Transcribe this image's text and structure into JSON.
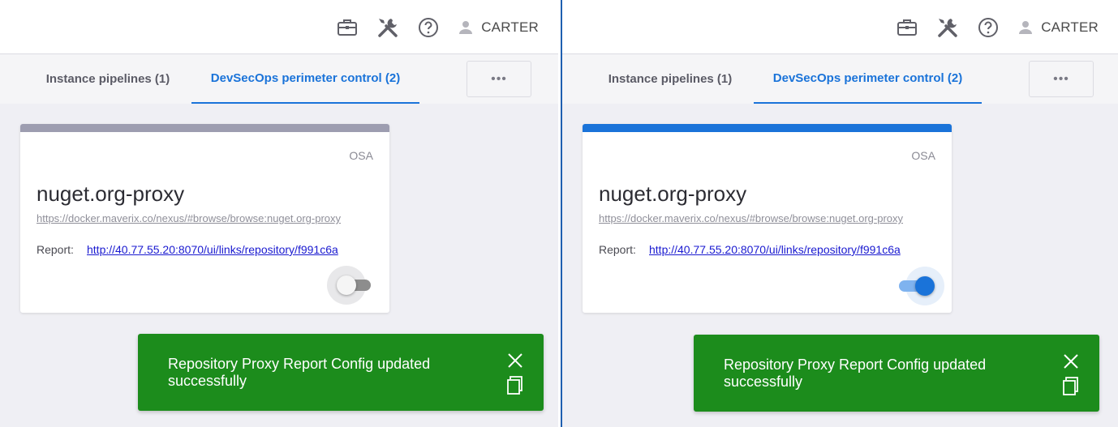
{
  "header": {
    "username": "CARTER",
    "icons": [
      "briefcase-icon",
      "tools-icon",
      "help-icon",
      "user-icon"
    ]
  },
  "tabs": [
    {
      "label": "Instance pipelines (1)",
      "active": false
    },
    {
      "label": "DevSecOps perimeter control (2)",
      "active": true
    }
  ],
  "more_label": "•••",
  "card": {
    "tag": "OSA",
    "title": "nuget.org-proxy",
    "url": "https://docker.maverix.co/nexus/#browse/browse:nuget.org-proxy",
    "report_label": "Report:",
    "report_link": "http://40.77.55.20:8070/ui/links/repository/f991c6a"
  },
  "panels": {
    "left": {
      "stripe_color": "#9d9db0",
      "toggle_on": false
    },
    "right": {
      "stripe_color": "#1a73d9",
      "toggle_on": true
    }
  },
  "toast": {
    "message": "Repository Proxy Report Config updated successfully",
    "background": "#1c8c1c"
  },
  "colors": {
    "accent": "#1a73d9",
    "divider": "#1f5fb0"
  }
}
